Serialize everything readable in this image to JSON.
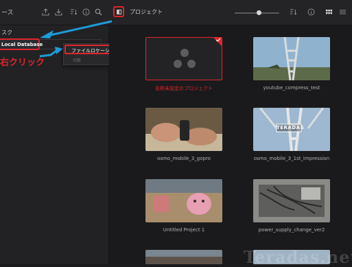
{
  "topbar": {
    "left_title": "ース",
    "main_title": "プロジェクト",
    "icons": [
      "export-icon",
      "import-icon",
      "sort-icon",
      "info-icon",
      "search-icon",
      "panel-toggle-icon",
      "sort-icon",
      "info-icon",
      "grid-view-icon",
      "list-view-icon"
    ],
    "zoom_level": 0.55
  },
  "sidebar": {
    "section_label": "スク",
    "database_item": "Local Database",
    "right_click_label": "右クリック"
  },
  "context_menu": {
    "items": [
      "ファイルロケーションを開く",
      "切断"
    ]
  },
  "projects": [
    {
      "name": "名称未設定のプロジェクト",
      "selected": true,
      "placeholder": true
    },
    {
      "name": "youtube_compress_test"
    },
    {
      "name": "osmo_mobile_3_gopro"
    },
    {
      "name": "osmo_mobile_3_1st_impression",
      "overlay_text": "TERADAS"
    },
    {
      "name": "Untitled Project 1"
    },
    {
      "name": "power_supply_change_ver2"
    }
  ],
  "watermark": "Teradas.net",
  "colors": {
    "accent_red": "#e0262b",
    "arrow_blue": "#1e9bd7"
  }
}
